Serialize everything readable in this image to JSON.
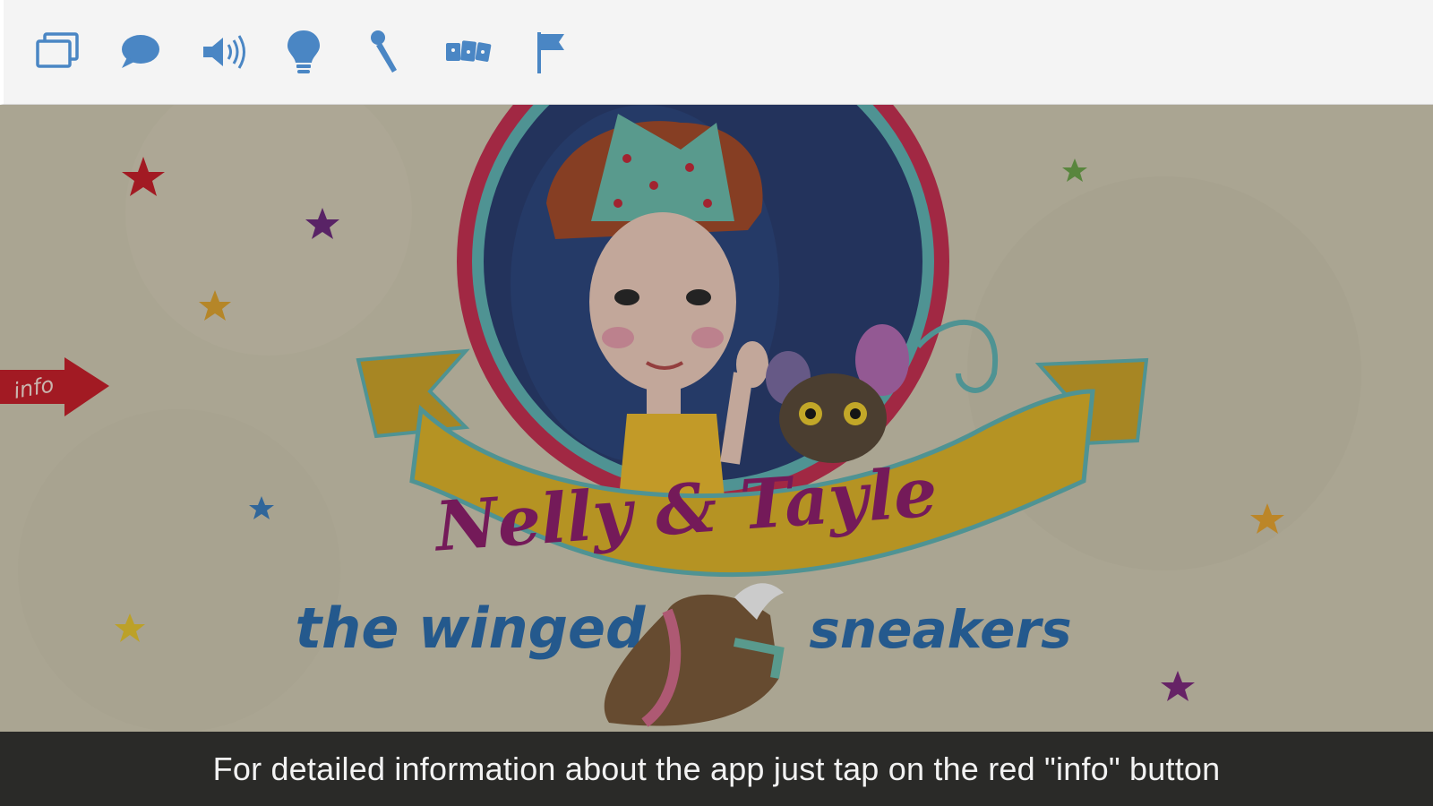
{
  "toolbar": {
    "icons": [
      {
        "name": "pages-icon"
      },
      {
        "name": "speech-bubble-icon"
      },
      {
        "name": "speaker-icon"
      },
      {
        "name": "lightbulb-icon"
      },
      {
        "name": "microphone-icon"
      },
      {
        "name": "puzzle-icon"
      },
      {
        "name": "flag-icon"
      }
    ],
    "icon_color": "#4a86c4"
  },
  "scene": {
    "title_line1": "Nelly & Tayle",
    "title_line2_left": "the winged",
    "title_line2_right": "sneakers",
    "info_button_label": "info"
  },
  "caption": {
    "text": "For detailed information about the app just tap on the red \"info\" button"
  },
  "colors": {
    "info_red": "#c2202a",
    "title_purple": "#8b1f6a",
    "subtitle_blue": "#2b6aa8",
    "banner_yellow": "#d8b02a"
  }
}
